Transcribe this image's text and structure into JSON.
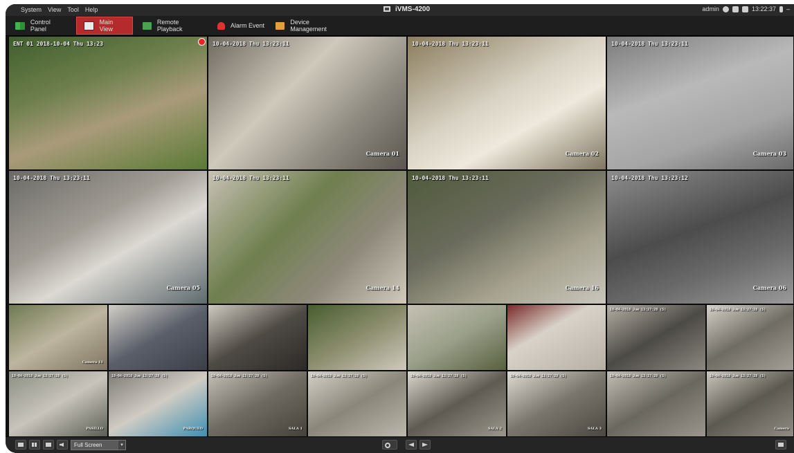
{
  "menu": [
    "System",
    "View",
    "Tool",
    "Help"
  ],
  "app_title": "iVMS-4200",
  "status": {
    "user": "admin",
    "time": "13:22:37"
  },
  "tabs": [
    {
      "label": "Control Panel",
      "icon": "control-panel-icon"
    },
    {
      "label": "Main View",
      "icon": "main-view-icon",
      "active": true
    },
    {
      "label": "Remote Playback",
      "icon": "remote-playback-icon"
    },
    {
      "label": "Alarm Event",
      "icon": "alarm-event-icon"
    },
    {
      "label": "Device Management",
      "icon": "device-management-icon"
    }
  ],
  "cameras": {
    "c1": {
      "ts": "ENT 01   2018-10-04 Thu 13:23",
      "cam": ""
    },
    "c2": {
      "ts": "10-04-2018 Thu 13:23:11",
      "cam": "Camera 01"
    },
    "c3": {
      "ts": "10-04-2018 Thu 13:23:11",
      "cam": "Camera 02"
    },
    "c4": {
      "ts": "10-04-2018 Thu 13:23:11",
      "cam": "Camera 03"
    },
    "c5": {
      "ts": "10-04-2018 Thu 13:23:11",
      "cam": "Camera 05"
    },
    "c6": {
      "ts": "10-04-2018 Thu 13:23:11",
      "cam": "Camera 14"
    },
    "c7": {
      "ts": "10-04-2018 Thu 13:23:11",
      "cam": "Camera 16"
    },
    "c8": {
      "ts": "10-04-2018 Thu 13:23:12",
      "cam": "Camera 06"
    },
    "c9": {
      "ts": "",
      "cam": "Camera 11"
    },
    "c10": {
      "ts": "",
      "cam": ""
    },
    "c11": {
      "ts": "",
      "cam": ""
    },
    "c12": {
      "ts": "",
      "cam": ""
    },
    "c13": {
      "ts": "",
      "cam": ""
    },
    "c14": {
      "ts": "",
      "cam": ""
    },
    "c15": {
      "ts": "10-04-2018 Jue 13:27:28 (S)",
      "cam": ""
    },
    "c16": {
      "ts": "10-04-2018 Jue 13:27:28 (S)",
      "cam": ""
    },
    "c17": {
      "ts": "10-04-2018 Jue 13:27:28 (S)",
      "cam": "PASILLO"
    },
    "c18": {
      "ts": "10-04-2018 Jue 13:27:28 (S)",
      "cam": "PARQUEO"
    },
    "c19": {
      "ts": "10-04-2018 Jue 13:27:28 (S)",
      "cam": "SALA 1"
    },
    "c20": {
      "ts": "10-04-2018 Jue 13:27:28 (S)",
      "cam": ""
    },
    "c21": {
      "ts": "10-04-2018 Jue 13:27:28 (S)",
      "cam": "SALA 2"
    },
    "c22": {
      "ts": "10-04-2018 Jue 13:27:28 (S)",
      "cam": "SALA 3"
    },
    "c23": {
      "ts": "10-04-2018 Jue 13:27:28 (S)",
      "cam": ""
    },
    "c24": {
      "ts": "10-04-2018 Jue 13:27:28 (S)",
      "cam": "Camera"
    }
  },
  "bottom": {
    "fullscreen_label": "Full Screen"
  }
}
